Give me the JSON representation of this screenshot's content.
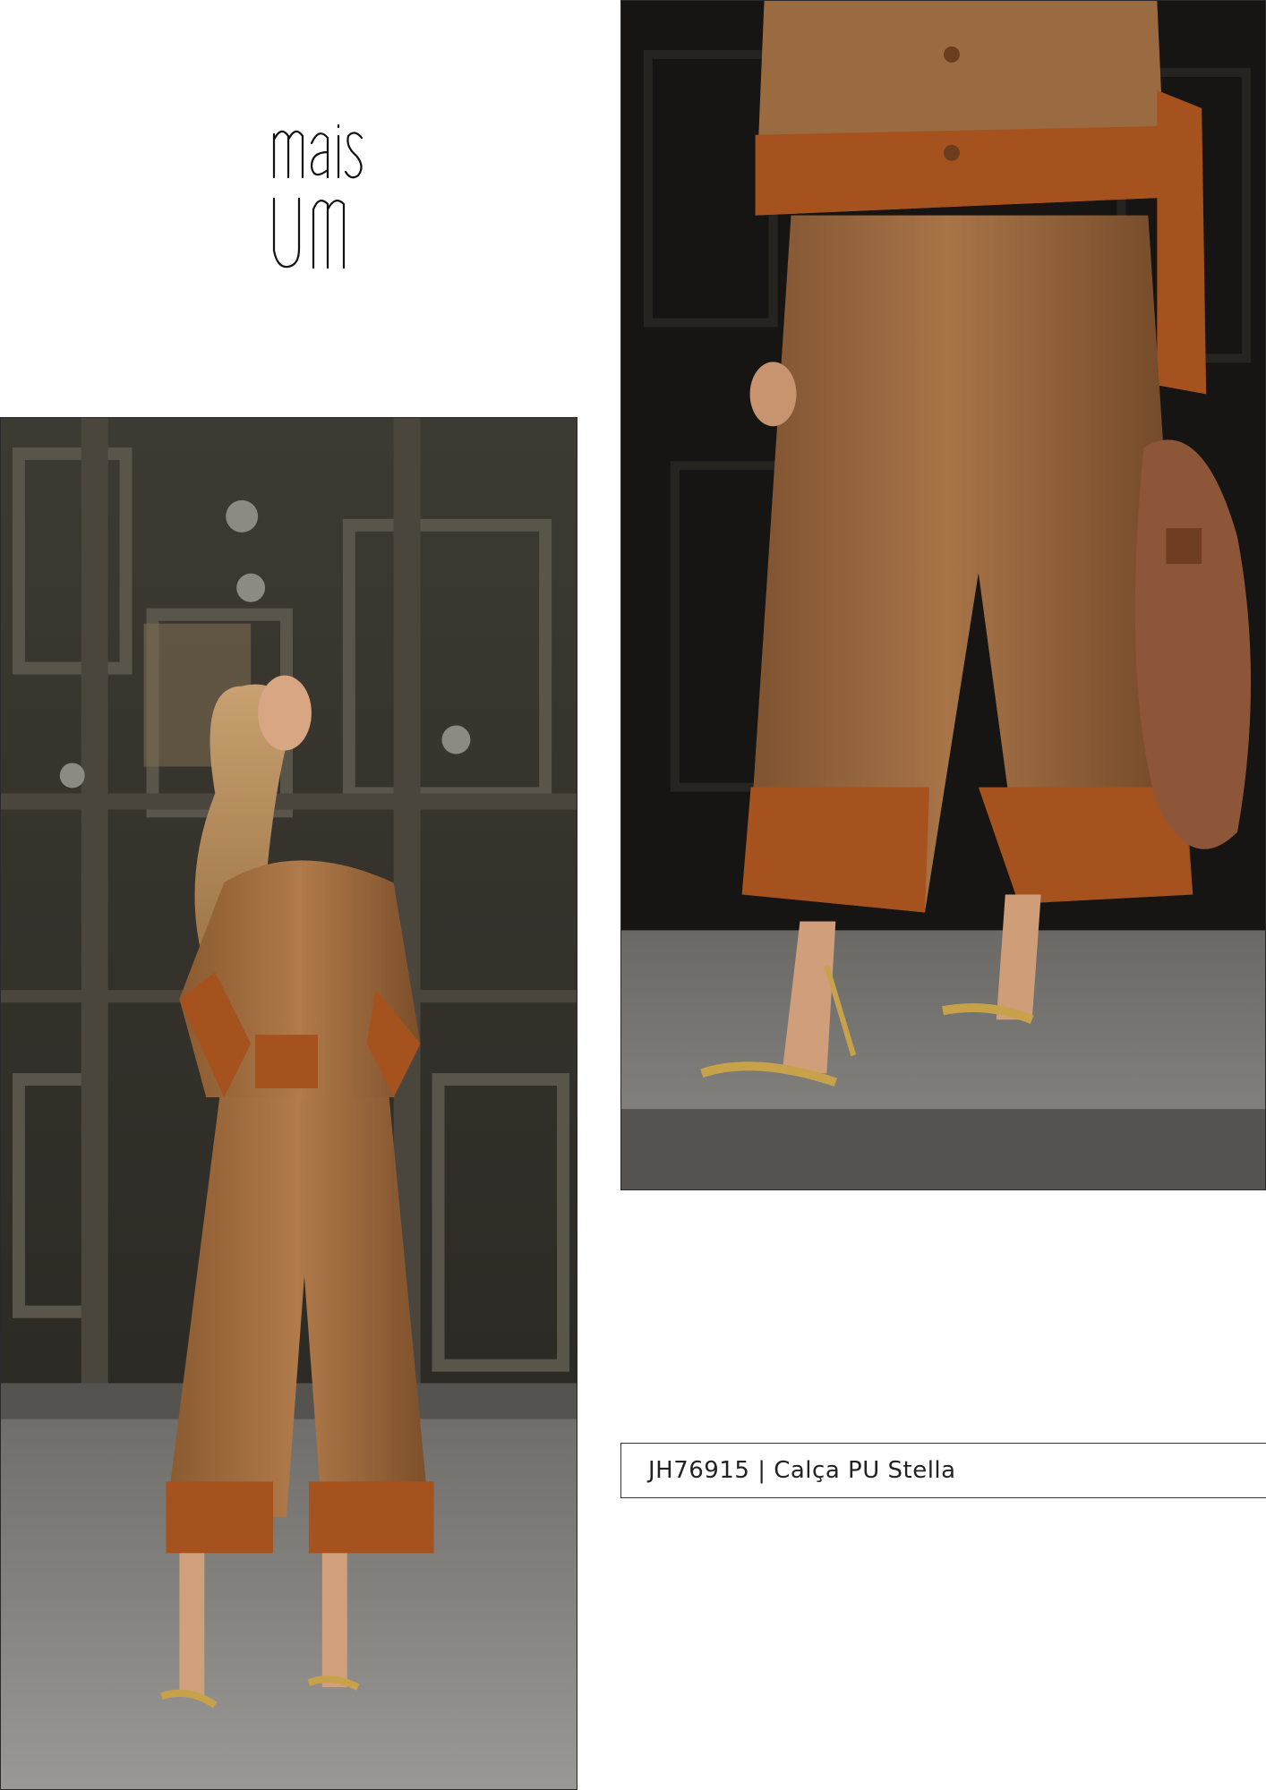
{
  "brand": {
    "logo_text": "mais UM"
  },
  "product": {
    "caption": "JH76915 | Calça PU Stella"
  },
  "colors": {
    "background": "#ffffff",
    "caption_text": "#222222",
    "leather_tan": "#a06a3c",
    "suede_rust": "#a8521f",
    "door_dark": "#2b2a26"
  },
  "images": {
    "left": "full-body-model-photo",
    "right": "trousers-closeup-photo"
  }
}
